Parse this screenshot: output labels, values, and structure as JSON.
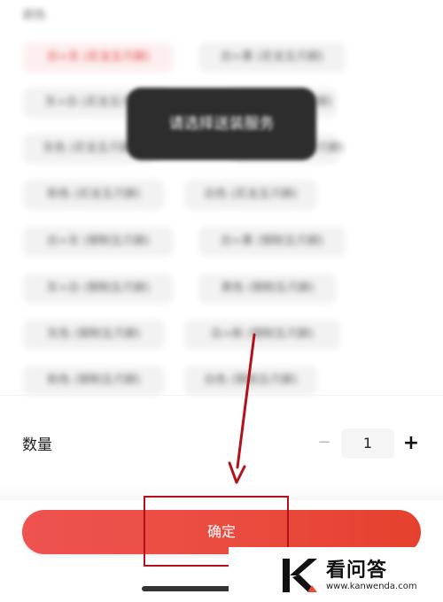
{
  "color_section": {
    "label": "颜色",
    "options": [
      {
        "label": "白+灰 (尼龙五爪脚)",
        "selected": true
      },
      {
        "label": "白+黄 (尼龙五爪脚)",
        "selected": false
      },
      {
        "label": "灰+白 (尼龙五爪脚)",
        "selected": false
      },
      {
        "label": "黑色 (尼龙五爪脚)",
        "selected": false
      },
      {
        "label": "灰色 (尼龙五爪脚)",
        "selected": false
      },
      {
        "label": "白+粉 (尼龙五爪脚)",
        "selected": false
      },
      {
        "label": "粉色 (尼龙五爪脚)",
        "selected": false
      },
      {
        "label": "白色 (尼龙五爪脚)",
        "selected": false
      },
      {
        "label": "白+灰 (钢制五爪脚)",
        "selected": false
      },
      {
        "label": "白+黄 (钢制五爪脚)",
        "selected": false
      },
      {
        "label": "灰+白 (钢制五爪脚)",
        "selected": false
      },
      {
        "label": "黑色 (钢制五爪脚)",
        "selected": false
      },
      {
        "label": "灰色 (钢制五爪脚)",
        "selected": false
      },
      {
        "label": "白+粉 (钢制五爪脚)",
        "selected": false
      },
      {
        "label": "粉色 (钢制五爪脚)",
        "selected": false
      },
      {
        "label": "白色 (钢制五爪脚)",
        "selected": false
      }
    ]
  },
  "toast": {
    "text": "请选择送装服务"
  },
  "quantity": {
    "label": "数量",
    "minus": "−",
    "value": "1",
    "plus": "+"
  },
  "confirm_button": {
    "label": "确定"
  },
  "watermark": {
    "title": "看问答",
    "url": "www.kanwenda.com"
  },
  "colors": {
    "accent": "#e94b3c",
    "annotation": "#b3121d",
    "selected_text": "#e03a3a"
  }
}
